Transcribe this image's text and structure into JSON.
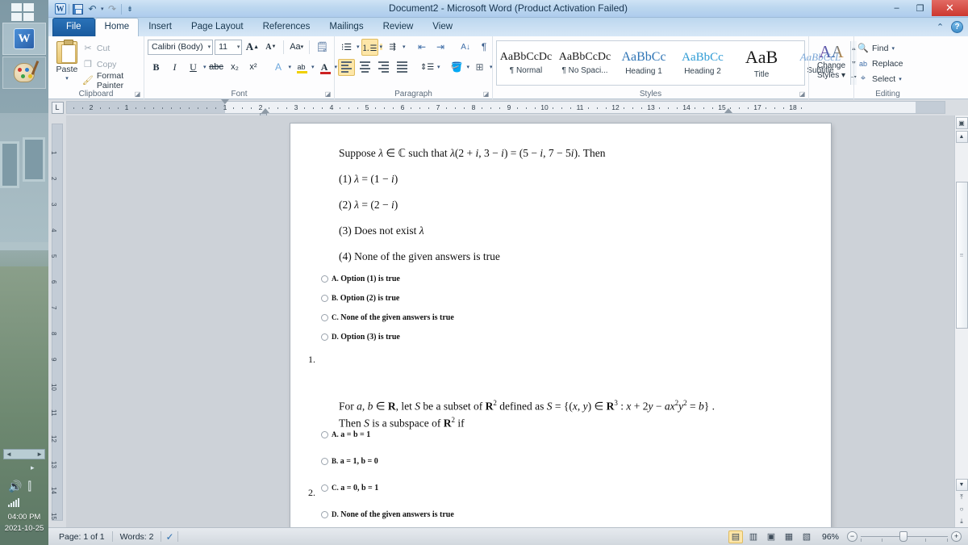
{
  "window": {
    "title": "Document2  -  Microsoft Word (Product Activation Failed)",
    "minimize": "–",
    "restore": "❐",
    "close": "✕"
  },
  "quick_access": {
    "word_mark": "W",
    "save": "save-icon",
    "undo": "↶",
    "redo": "↷",
    "customize": "⇟"
  },
  "tabs": [
    {
      "label": "File"
    },
    {
      "label": "Home"
    },
    {
      "label": "Insert"
    },
    {
      "label": "Page Layout"
    },
    {
      "label": "References"
    },
    {
      "label": "Mailings"
    },
    {
      "label": "Review"
    },
    {
      "label": "View"
    }
  ],
  "tabs_right": {
    "collapse_ribbon": "⌃",
    "help": "?"
  },
  "ribbon": {
    "clipboard": {
      "group_label": "Clipboard",
      "paste": "Paste",
      "paste_arrow": "▾",
      "cut": "Cut",
      "copy": "Copy",
      "format_painter": "Format Painter",
      "launcher": "◪"
    },
    "font": {
      "group_label": "Font",
      "font_name": "Calibri (Body)",
      "font_size": "11",
      "grow_font": "A",
      "shrink_font": "A",
      "change_case": "Aa",
      "clear_formatting": "⌫",
      "bold": "B",
      "italic": "I",
      "underline": "U",
      "strikethrough": "abc",
      "subscript": "x₂",
      "superscript": "x²",
      "text_effects": "A",
      "highlight": "ab",
      "font_color": "A",
      "launcher": "◪"
    },
    "paragraph": {
      "group_label": "Paragraph",
      "bullets": "☰",
      "numbering": "☷",
      "multilevel": "☶",
      "decrease_indent": "⇤",
      "increase_indent": "⇥",
      "sort": "A↓",
      "show_marks": "¶",
      "align_left": "align-left",
      "align_center": "align-center",
      "align_right": "align-right",
      "justify": "justify",
      "line_spacing": "↕",
      "shading": "▨",
      "borders": "⊞",
      "launcher": "◪"
    },
    "styles": {
      "group_label": "Styles",
      "items": [
        {
          "preview": "AaBbCcDc",
          "name": "¶ Normal"
        },
        {
          "preview": "AaBbCcDc",
          "name": "¶ No Spaci..."
        },
        {
          "preview": "AaBbCc",
          "name": "Heading 1"
        },
        {
          "preview": "AaBbCc",
          "name": "Heading 2"
        },
        {
          "preview": "AaB",
          "name": "Title"
        },
        {
          "preview": "AaBbCcL",
          "name": "Subtitle"
        }
      ],
      "scroll_up": "▲",
      "scroll_down": "▼",
      "more": "▾",
      "launcher": "◪"
    },
    "change_styles": {
      "glyph": "AA",
      "line1": "Change",
      "line2": "Styles ▾"
    },
    "editing": {
      "group_label": "Editing",
      "find": "Find",
      "find_arrow": "▾",
      "replace": "Replace",
      "select": "Select",
      "select_arrow": "▾"
    }
  },
  "ruler": {
    "tab_selector": "L",
    "numbers": [
      "2",
      "1",
      "1",
      "2",
      "3",
      "4",
      "5",
      "6",
      "7",
      "8",
      "9",
      "10",
      "11",
      "12",
      "13",
      "14",
      "15",
      "17",
      "18"
    ]
  },
  "document": {
    "questions": [
      {
        "number": "1.",
        "stem": "Suppose λ ∈ ℂ such that λ(2 + i, 3 − i) = (5 − i, 7 − 5i). Then",
        "choices": [
          "(1) λ = (1 − i)",
          "(2) λ = (2 − i)",
          "(3) Does not exist λ",
          "(4) None of the given answers is true"
        ],
        "options": [
          {
            "letter": "A.",
            "text": "Option (1)  is true"
          },
          {
            "letter": "B.",
            "text": "Option (2)  is true"
          },
          {
            "letter": "C.",
            "text": "None of the given answers is true"
          },
          {
            "letter": "D.",
            "text": "Option (3)  is true"
          }
        ]
      },
      {
        "number": "2.",
        "stem_line1": "For a, b ∈ R, let S be a subset of R² defined as S = {(x, y) ∈ R³ : x + 2y − ax²y² = b} .",
        "stem_line2": "Then S is a subspace of R² if",
        "options": [
          {
            "letter": "A.",
            "text": "a = b = 1"
          },
          {
            "letter": "B.",
            "text": "a = 1, b = 0"
          },
          {
            "letter": "C.",
            "text": "a = 0, b = 1"
          },
          {
            "letter": "D.",
            "text": "None of the given answers is true"
          }
        ]
      }
    ]
  },
  "scrollbar": {
    "up": "▲",
    "down": "▼",
    "prev_page": "⤒",
    "select_object": "○",
    "next_page": "⤓",
    "split": "▣"
  },
  "statusbar": {
    "page": "Page: 1 of 1",
    "words": "Words: 2",
    "proofing": "proofing-icon",
    "views": [
      {
        "name": "print-layout-view",
        "glyph": "▤",
        "active": true
      },
      {
        "name": "full-screen-reading-view",
        "glyph": "▥",
        "active": false
      },
      {
        "name": "web-layout-view",
        "glyph": "▣",
        "active": false
      },
      {
        "name": "outline-view",
        "glyph": "▦",
        "active": false
      },
      {
        "name": "draft-view",
        "glyph": "▧",
        "active": false
      }
    ],
    "zoom": "96%",
    "zoom_out": "−",
    "zoom_in": "+"
  },
  "taskbar": {
    "start": "start-button",
    "word_app": "W",
    "paint_app": "paint-icon",
    "tray_volume": "🔊",
    "tray_network": "network-icon",
    "clock_time": "04:00 PM",
    "clock_date": "2021-10-25"
  },
  "colors": {
    "accent": "#2a72b8",
    "close": "#cc3830",
    "highlight": "#fde6a8"
  }
}
